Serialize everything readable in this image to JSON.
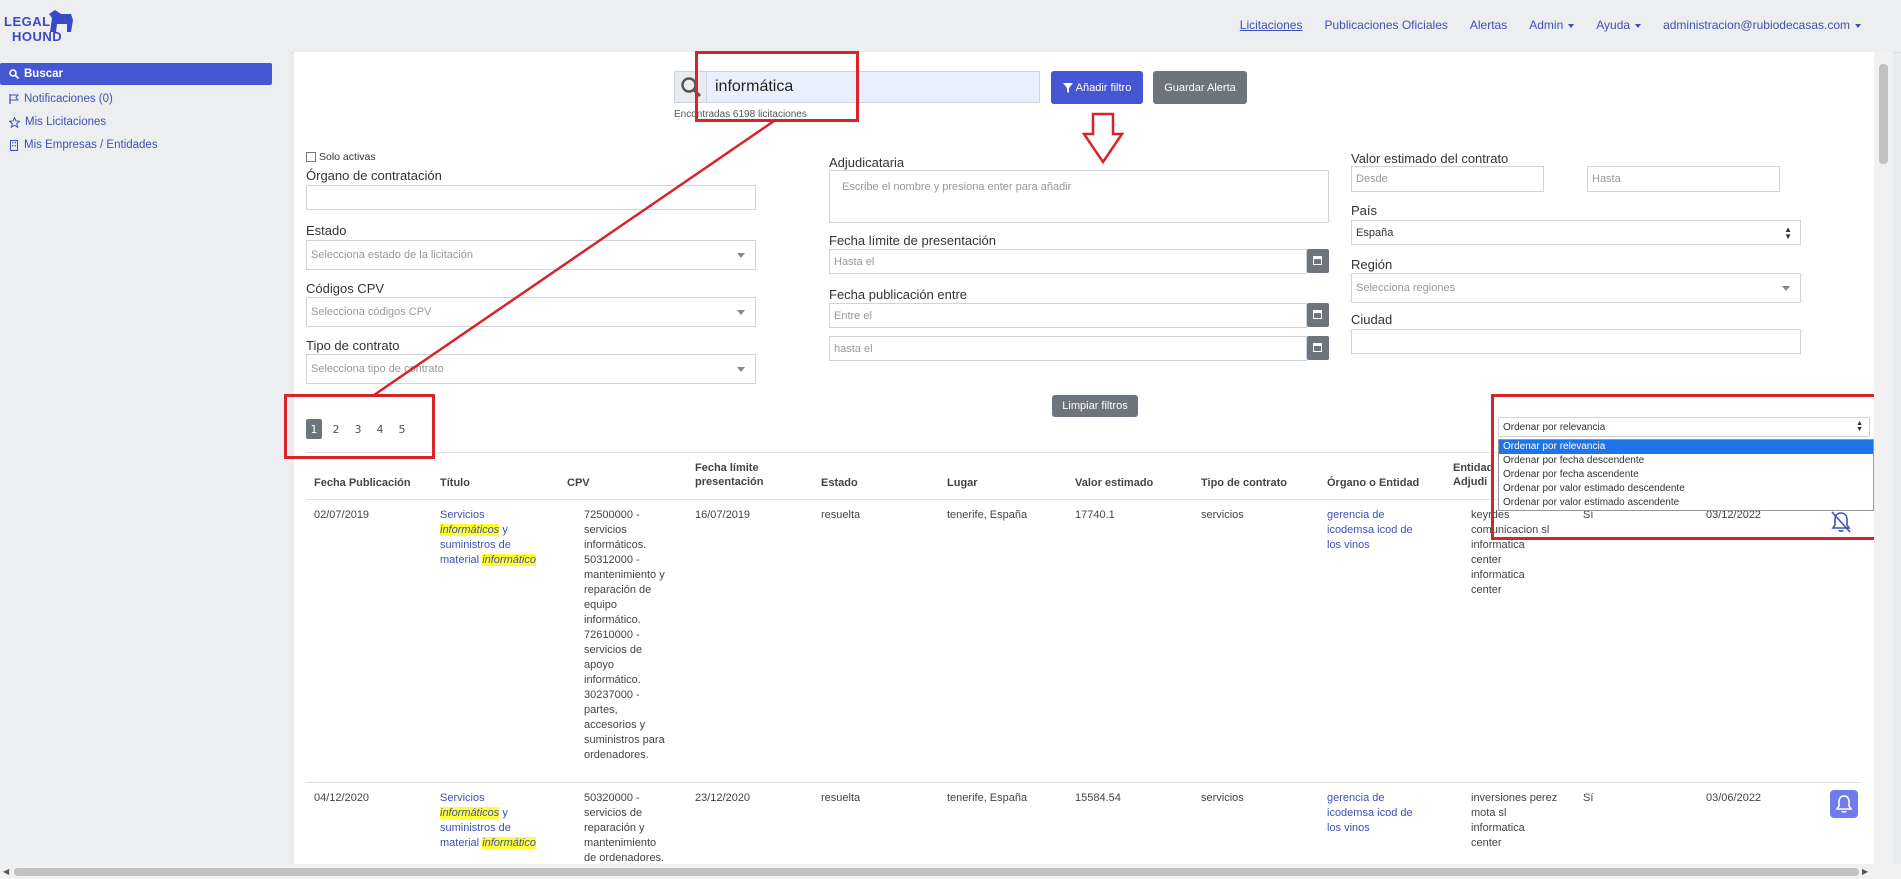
{
  "brand": {
    "line1": "LEGAL",
    "line2": "HOUND"
  },
  "topnav": {
    "licitaciones": "Licitaciones",
    "publicaciones": "Publicaciones Oficiales",
    "alertas": "Alertas",
    "admin": "Admin",
    "ayuda": "Ayuda",
    "user": "administracion@rubiodecasas.com"
  },
  "sidebar": {
    "buscar": "Buscar",
    "notificaciones": "Notificaciones (0)",
    "mis_licitaciones": "Mis Licitaciones",
    "mis_empresas": "Mis Empresas / Entidades"
  },
  "search": {
    "value": "informática",
    "found": "Encontradas 6198 licitaciones",
    "add_filter": "Añadir filtro",
    "save_alert": "Guardar Alerta"
  },
  "filters": {
    "solo_activas": "Solo activas",
    "organo_label": "Órgano de contratación",
    "estado_label": "Estado",
    "estado_placeholder": "Selecciona estado de la licitación",
    "cpv_label": "Códigos CPV",
    "cpv_placeholder": "Selecciona códigos CPV",
    "tipo_label": "Tipo de contrato",
    "tipo_placeholder": "Selecciona tipo de contrato",
    "adjudicataria_label": "Adjudicataria",
    "adjudicataria_placeholder": "Escribe el nombre y presiona enter para añadir",
    "fecha_limite_label": "Fecha límite de presentación",
    "fecha_limite_placeholder": "Hasta el",
    "fecha_pub_label": "Fecha publicación entre",
    "fecha_pub_from": "Entre el",
    "fecha_pub_to": "hasta el",
    "valor_label": "Valor estimado del contrato",
    "valor_desde": "Desde",
    "valor_hasta": "Hasta",
    "pais_label": "País",
    "pais_value": "España",
    "region_label": "Región",
    "region_placeholder": "Selecciona regiones",
    "ciudad_label": "Ciudad",
    "clear": "Limpiar filtros"
  },
  "pagination": [
    "1",
    "2",
    "3",
    "4",
    "5"
  ],
  "sort": {
    "selected": "Ordenar por relevancia",
    "options": [
      "Ordenar por relevancia",
      "Ordenar por fecha descendente",
      "Ordenar por fecha ascendente",
      "Ordenar por valor estimado descendente",
      "Ordenar por valor estimado ascendente"
    ]
  },
  "table": {
    "headers": {
      "fecha_pub": "Fecha Publicación",
      "titulo": "Título",
      "cpv": "CPV",
      "fecha_limite_1": "Fecha límite",
      "fecha_limite_2": "presentación",
      "estado": "Estado",
      "lugar": "Lugar",
      "valor": "Valor estimado",
      "tipo": "Tipo de contrato",
      "organo": "Órgano o Entidad",
      "entidad_1": "Entidad",
      "entidad_2": "Adjudi"
    },
    "rows": [
      {
        "fecha": "02/07/2019",
        "titulo_a": "Servicios",
        "titulo_hl1": "informáticos",
        "titulo_b": "y",
        "titulo_c": "suministros de",
        "titulo_d": "material",
        "titulo_hl2": "informático",
        "cpv": [
          "72500000 -",
          "servicios",
          "informáticos.",
          "50312000 -",
          "mantenimiento y",
          "reparación de",
          "equipo",
          "informático.",
          "72610000 -",
          "servicios de",
          "apoyo",
          "informático.",
          "30237000 -",
          "partes,",
          "accesorios y",
          "suministros para",
          "ordenadores."
        ],
        "fecha_limite": "16/07/2019",
        "estado": "resuelta",
        "lugar": "tenerife, España",
        "valor": "17740.1",
        "tipo": "servicios",
        "organo": [
          "gerencia de",
          "icodemsa icod de",
          "los vinos"
        ],
        "entidad": [
          "keyrdes",
          "comunicacion sl",
          "informatica",
          "center",
          "informatica",
          "center"
        ],
        "si": "Sí",
        "fecha_fin": "03/12/2022"
      },
      {
        "fecha": "04/12/2020",
        "titulo_a": "Servicios",
        "titulo_hl1": "informáticos",
        "titulo_b": "y",
        "titulo_c": "suministros de",
        "titulo_d": "material",
        "titulo_hl2": "informático",
        "cpv": [
          "50320000 -",
          "servicios de",
          "reparación y",
          "mantenimiento",
          "de ordenadores."
        ],
        "fecha_limite": "23/12/2020",
        "estado": "resuelta",
        "lugar": "tenerife, España",
        "valor": "15584.54",
        "tipo": "servicios",
        "organo": [
          "gerencia de",
          "icodemsa icod de",
          "los vinos"
        ],
        "entidad": [
          "inversiones perez",
          "mota sl",
          "informatica",
          "center"
        ],
        "si": "Sí",
        "fecha_fin": "03/06/2022"
      }
    ]
  },
  "colors": {
    "primary": "#4556d3",
    "secondary": "#6c757d",
    "annotation": "#d8232a",
    "highlight": "#ffff33"
  }
}
